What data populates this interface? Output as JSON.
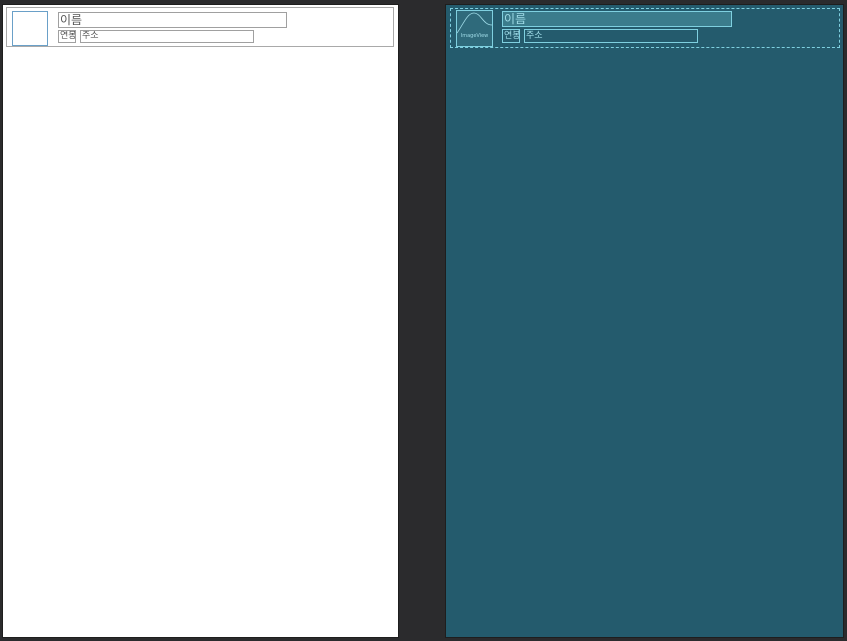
{
  "design_view": {
    "item": {
      "name": "이름",
      "age": "연봉",
      "address": "주소"
    }
  },
  "blueprint_view": {
    "item": {
      "image_label": "ImageView",
      "name": "이름",
      "age": "연봉",
      "address": "주소"
    }
  },
  "colors": {
    "workspace": "#2b2b2d",
    "design_background": "#ffffff",
    "blueprint_background": "#245b6d",
    "blueprint_outline": "#7fd0e0"
  },
  "icons": {
    "image_placeholder": "image-placeholder-icon"
  }
}
